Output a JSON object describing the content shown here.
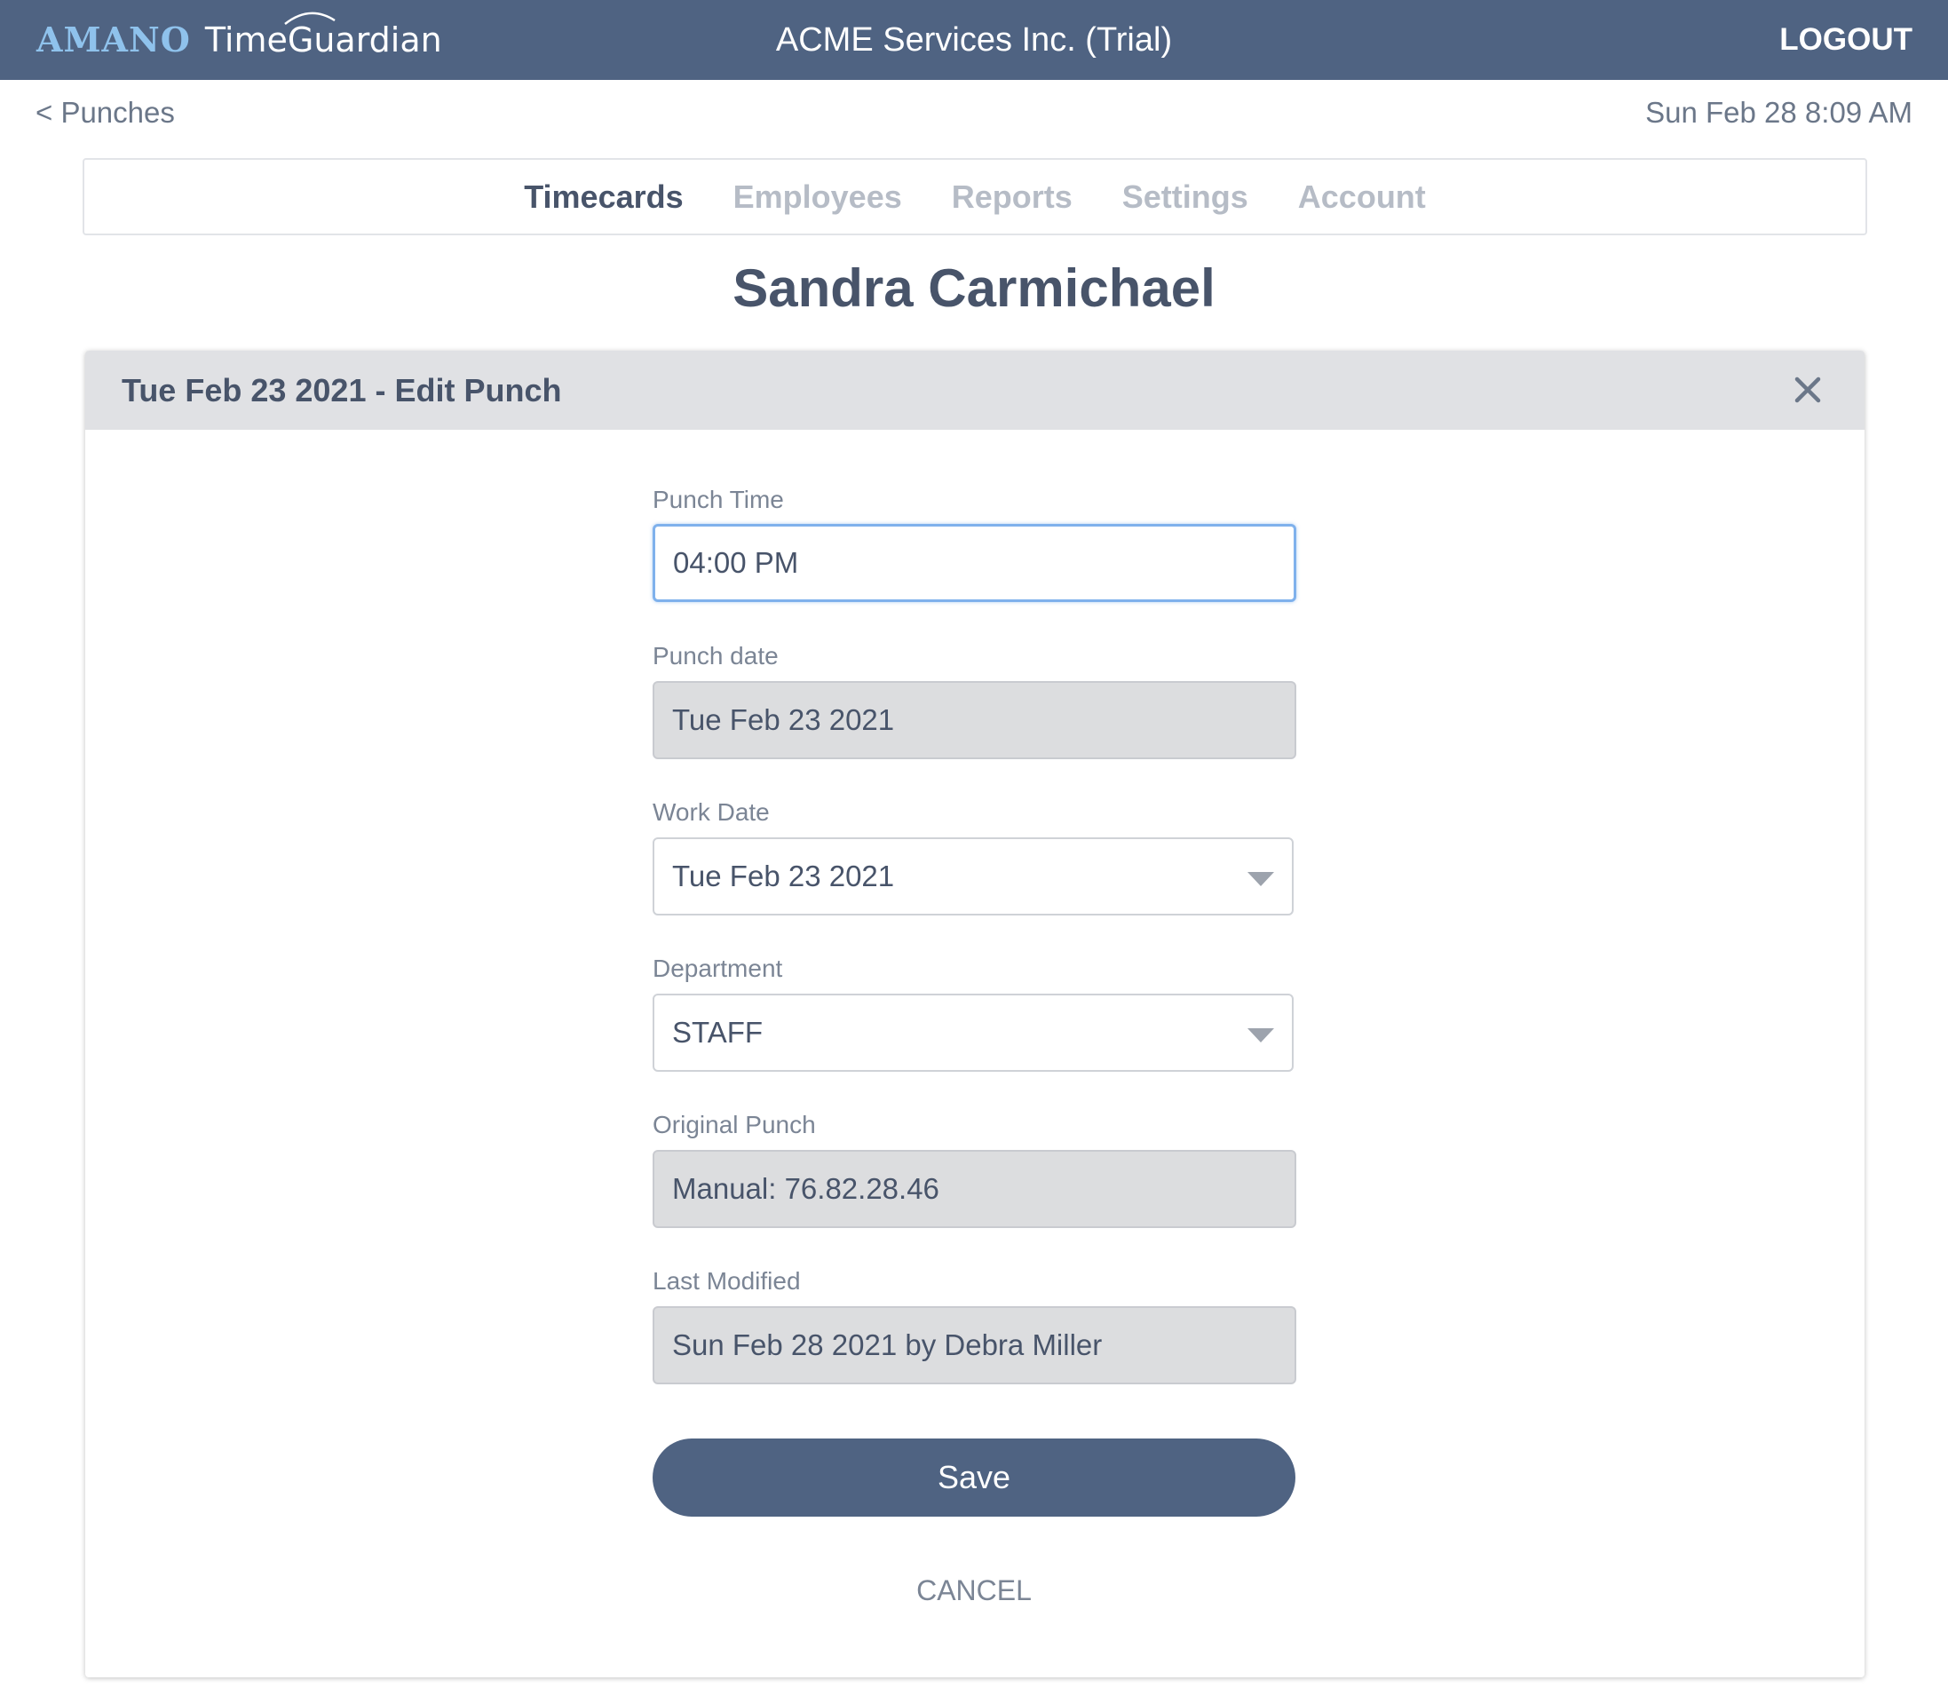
{
  "header": {
    "logo_brand": "AMANO",
    "logo_product": "TimeGuardian",
    "company": "ACME Services Inc. (Trial)",
    "logout_label": "LOGOUT"
  },
  "subheader": {
    "back_label": "< Punches",
    "datetime": "Sun Feb 28 8:09 AM"
  },
  "nav": {
    "tabs": [
      {
        "label": "Timecards",
        "active": true
      },
      {
        "label": "Employees",
        "active": false
      },
      {
        "label": "Reports",
        "active": false
      },
      {
        "label": "Settings",
        "active": false
      },
      {
        "label": "Account",
        "active": false
      }
    ]
  },
  "employee": {
    "name": "Sandra Carmichael"
  },
  "panel": {
    "title": "Tue Feb 23 2021 - Edit Punch",
    "fields": {
      "punch_time": {
        "label": "Punch Time",
        "value": "04:00 PM"
      },
      "punch_date": {
        "label": "Punch date",
        "value": "Tue Feb 23 2021"
      },
      "work_date": {
        "label": "Work Date",
        "value": "Tue Feb 23 2021"
      },
      "department": {
        "label": "Department",
        "value": "STAFF"
      },
      "original_punch": {
        "label": "Original Punch",
        "value": "Manual: 76.82.28.46"
      },
      "last_modified": {
        "label": "Last Modified",
        "value": "Sun Feb 28 2021 by Debra Miller"
      }
    },
    "save_label": "Save",
    "cancel_label": "CANCEL"
  },
  "colors": {
    "header_bg": "#4f6382",
    "logo_accent": "#8fc2ec",
    "focus_ring": "#7fb1ec",
    "readonly_bg": "#dcdddf"
  }
}
